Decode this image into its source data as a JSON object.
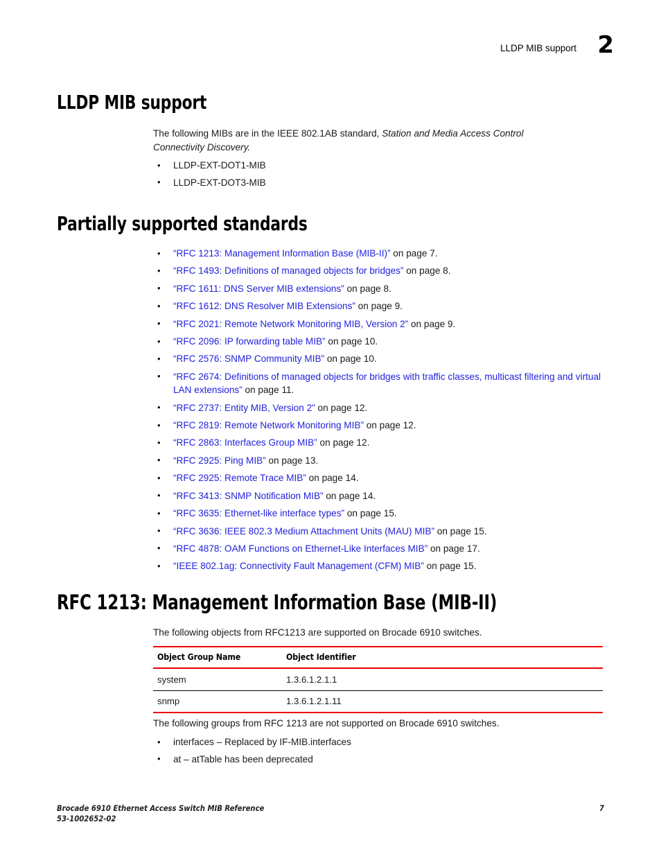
{
  "header": {
    "running_title": "LLDP MIB support",
    "chapter_number": "2"
  },
  "sections": {
    "lldp": {
      "heading": "LLDP MIB support",
      "intro_lead": "The following MIBs are in the IEEE 802.1AB standard, ",
      "intro_italic": "Station and Media Access Control Connectivity Discovery.",
      "items": [
        "LLDP-EXT-DOT1-MIB",
        "LLDP-EXT-DOT3-MIB"
      ]
    },
    "partially_supported": {
      "heading": "Partially supported standards",
      "items": [
        {
          "link": "“RFC 1213: Management Information Base (MIB-II)”",
          "tail": " on page 7."
        },
        {
          "link": "“RFC 1493: Definitions of managed objects for bridges”",
          "tail": " on page 8."
        },
        {
          "link": "“RFC 1611: DNS Server MIB extensions”",
          "tail": " on page 8."
        },
        {
          "link": "“RFC 1612: DNS Resolver MIB Extensions”",
          "tail": " on page 9."
        },
        {
          "link": "“RFC 2021: Remote Network Monitoring MIB, Version 2”",
          "tail": " on page 9."
        },
        {
          "link": "“RFC 2096: IP forwarding table MIB”",
          "tail": " on page 10."
        },
        {
          "link": "“RFC 2576: SNMP Community MIB”",
          "tail": " on page 10."
        },
        {
          "link": "“RFC 2674: Definitions of managed objects for bridges with traffic classes, multicast filtering and virtual LAN extensions”",
          "tail": " on page 11."
        },
        {
          "link": "“RFC 2737: Entity MIB, Version 2”",
          "tail": " on page 12."
        },
        {
          "link": "“RFC 2819: Remote Network Monitoring MIB”",
          "tail": " on page 12."
        },
        {
          "link": "“RFC 2863: Interfaces Group MIB”",
          "tail": " on page 12."
        },
        {
          "link": "“RFC 2925: Ping MIB”",
          "tail": " on page 13."
        },
        {
          "link": "“RFC 2925: Remote Trace MIB”",
          "tail": " on page 14."
        },
        {
          "link": "“RFC 3413: SNMP Notification MIB”",
          "tail": " on page 14."
        },
        {
          "link": "“RFC 3635: Ethernet-like interface types”",
          "tail": " on page 15."
        },
        {
          "link": "“RFC 3636: IEEE 802.3 Medium Attachment Units (MAU) MIB”",
          "tail": " on page 15."
        },
        {
          "link": "“RFC 4878: OAM Functions on Ethernet-Like Interfaces MIB”",
          "tail": " on page 17."
        },
        {
          "link": "“IEEE 802.1ag: Connectivity Fault Management (CFM) MIB”",
          "tail": " on page 15."
        }
      ]
    },
    "rfc1213": {
      "heading": "RFC 1213: Management Information Base (MIB-II)",
      "intro": "The following objects from RFC1213 are supported on Brocade 6910 switches.",
      "table": {
        "columns": [
          "Object Group Name",
          "Object Identifier"
        ],
        "rows": [
          [
            "system",
            "1.3.6.1.2.1.1"
          ],
          [
            "snmp",
            "1.3.6.1.2.1.11"
          ]
        ]
      },
      "outro": "The following groups from RFC 1213 are not supported on Brocade 6910 switches.",
      "unsupported_items": [
        "interfaces – Replaced by IF-MIB.interfaces",
        "at – atTable has been deprecated"
      ]
    }
  },
  "footer": {
    "doc_title": "Brocade 6910 Ethernet Access Switch MIB Reference",
    "doc_number": "53-1002652-02",
    "page_number": "7"
  },
  "colors": {
    "link": "#2222dd",
    "table_rule": "#ee0000",
    "text": "#1a1a1a"
  }
}
